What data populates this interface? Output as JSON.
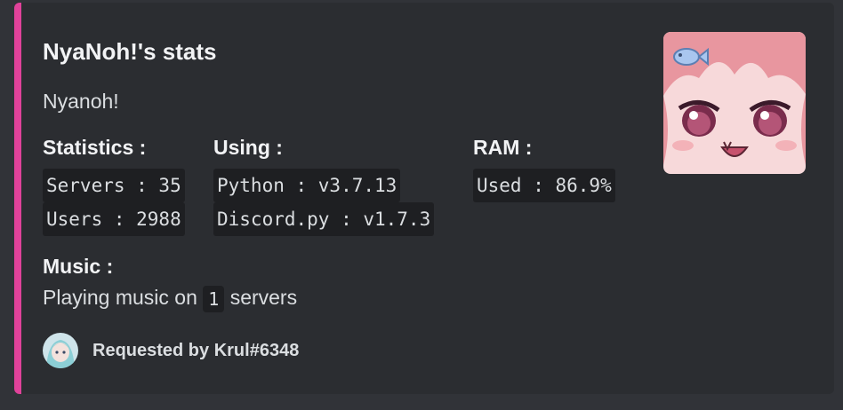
{
  "embed": {
    "accent_color": "#e0429a",
    "title": "NyaNoh!'s stats",
    "description": "Nyanoh!",
    "fields": {
      "statistics": {
        "name": "Statistics :",
        "lines": [
          "Servers : 35",
          "Users : 2988"
        ]
      },
      "using": {
        "name": "Using :",
        "lines": [
          "Python : v3.7.13",
          "Discord.py : v1.7.3"
        ]
      },
      "ram": {
        "name": "RAM :",
        "lines": [
          "Used : 86.9%"
        ]
      },
      "music": {
        "name": "Music :",
        "prefix": "Playing music on",
        "count": "1",
        "suffix": "servers"
      }
    },
    "thumbnail_icon": "anime-girl-avatar",
    "footer": {
      "text": "Requested by Krul#6348",
      "avatar_icon": "user-avatar"
    }
  }
}
